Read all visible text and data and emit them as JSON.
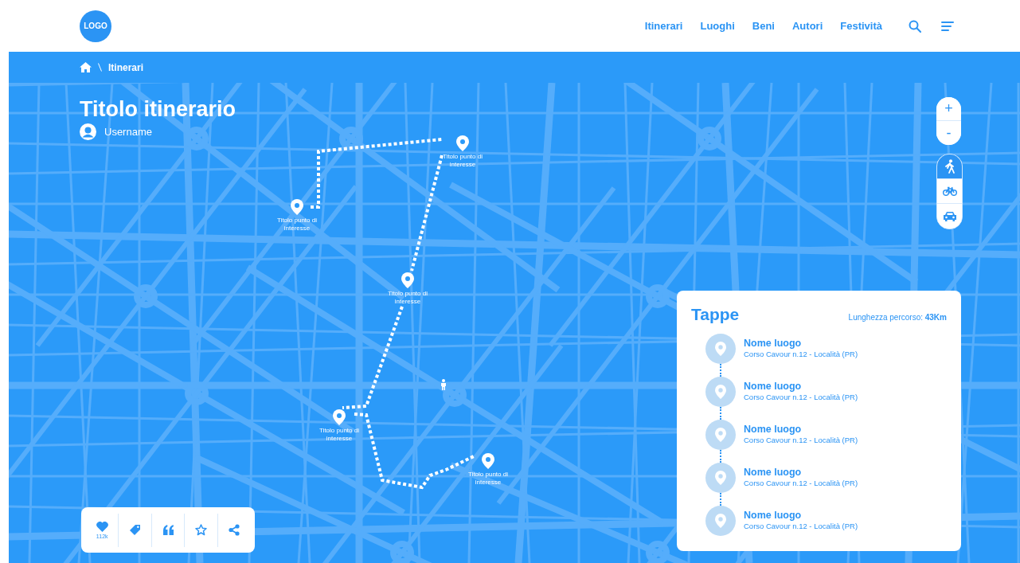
{
  "header": {
    "logo": "LOGO",
    "nav": [
      {
        "label": "Itinerari",
        "selected": false
      },
      {
        "label": "Luoghi",
        "selected": false
      },
      {
        "label": "Beni",
        "selected": false
      },
      {
        "label": "Autori",
        "selected": false
      },
      {
        "label": "Festività",
        "selected": false
      }
    ]
  },
  "breadcrumb": [
    "Itinerari"
  ],
  "title": "Titolo itinerario",
  "username": "Username",
  "pins": [
    {
      "label": "Titolo punto di interesse"
    },
    {
      "label": "Titolo punto di interesse"
    },
    {
      "label": "Titolo punto di interesse"
    },
    {
      "label": "Titolo punto di interesse"
    },
    {
      "label": "Titolo punto di interesse"
    }
  ],
  "zoom": [
    "+",
    "-"
  ],
  "travel_modes": [
    {
      "kind": "walk",
      "selected": true
    },
    {
      "kind": "bike",
      "selected": false
    },
    {
      "kind": "car",
      "selected": false
    }
  ],
  "stages": {
    "title": "Tappe",
    "length": "Lunghezza percorso: **43Km**",
    "items": [
      {
        "name": "Nome luogo",
        "address": "Corso Cavour n.12 - Località (PR)"
      },
      {
        "name": "Nome luogo",
        "address": "Corso Cavour n.12 - Località (PR)"
      },
      {
        "name": "Nome luogo",
        "address": "Corso Cavour n.12 - Località (PR)"
      },
      {
        "name": "Nome luogo",
        "address": "Corso Cavour n.12 - Località (PR)"
      },
      {
        "name": "Nome luogo",
        "address": "Corso Cavour n.12 - Località (PR)"
      }
    ]
  },
  "actions": [
    {
      "kind": "like",
      "count": "112k"
    },
    {
      "kind": "tag"
    },
    {
      "kind": "quote"
    },
    {
      "kind": "star"
    },
    {
      "kind": "share"
    }
  ]
}
